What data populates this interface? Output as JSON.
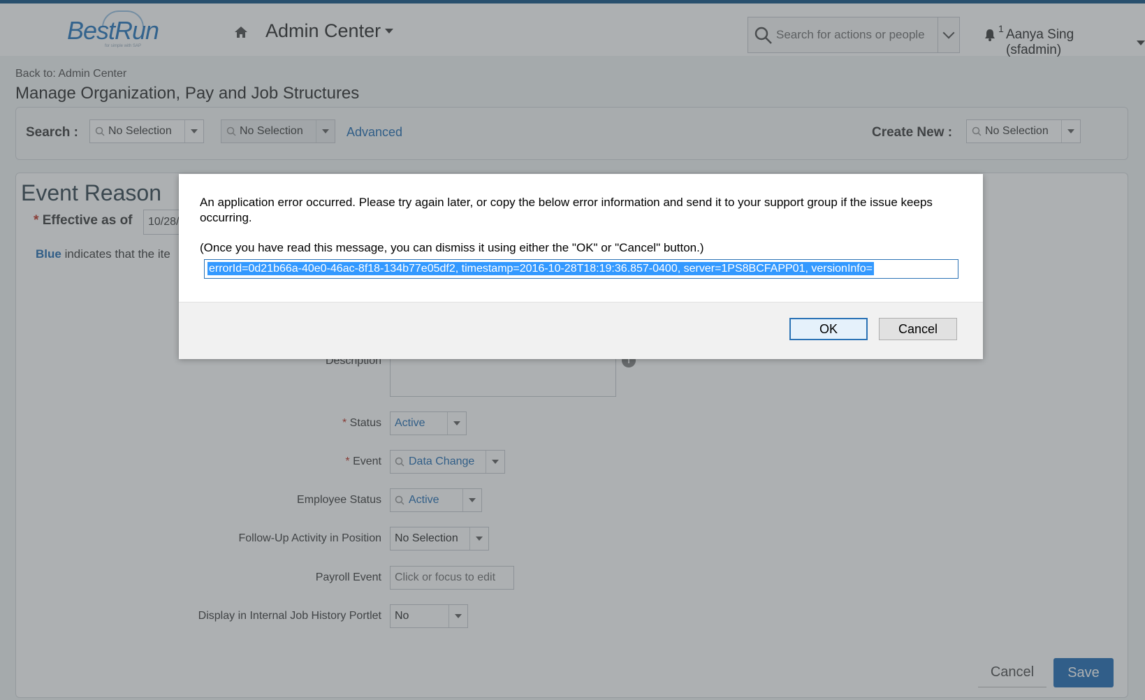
{
  "header": {
    "logo_text": "BestRun",
    "logo_tagline": "for simple with SAP",
    "app_title": "Admin Center",
    "search_placeholder": "Search for actions or people",
    "notification_count": "1",
    "user_name": "Aanya Sing (sfadmin)"
  },
  "page": {
    "back_link": "Back to: Admin Center",
    "title": "Manage Organization, Pay and Job Structures"
  },
  "search_bar": {
    "search_label": "Search :",
    "search_type_value": "No Selection",
    "search_item_value": "No Selection",
    "advanced_link": "Advanced",
    "create_new_label": "Create New :",
    "create_new_value": "No Selection"
  },
  "form": {
    "section_title": "Event Reason",
    "effective_label": "Effective as of",
    "effective_value": "10/28/",
    "legend_blue": "Blue",
    "legend_text": "indicates that the ite",
    "fields": {
      "description_label": "Description",
      "status_label": "Status",
      "status_value": "Active",
      "event_label": "Event",
      "event_value": "Data Change",
      "employee_status_label": "Employee Status",
      "employee_status_value": "Active",
      "follow_up_label": "Follow-Up Activity in Position",
      "follow_up_value": "No Selection",
      "payroll_event_label": "Payroll Event",
      "payroll_event_placeholder": "Click or focus to edit",
      "display_history_label": "Display in Internal Job History Portlet",
      "display_history_value": "No"
    },
    "cancel_label": "Cancel",
    "save_label": "Save"
  },
  "dialog": {
    "message": "An application error occurred. Please try again later, or copy the below error information and send it to your support group if the issue keeps occurring.",
    "hint": "(Once you have read this message, you can dismiss it using either the \"OK\" or \"Cancel\" button.)",
    "error_info": "errorId=0d21b66a-40e0-46ac-8f18-134b77e05df2, timestamp=2016-10-28T18:19:36.857-0400, server=1PS8BCFAPP01, versionInfo=",
    "ok_label": "OK",
    "cancel_label": "Cancel"
  },
  "colors": {
    "accent": "#2a72b5",
    "header_border": "#1c5a8a",
    "selection": "#3399ff",
    "overlay": "rgba(60,66,72,0.42)"
  }
}
